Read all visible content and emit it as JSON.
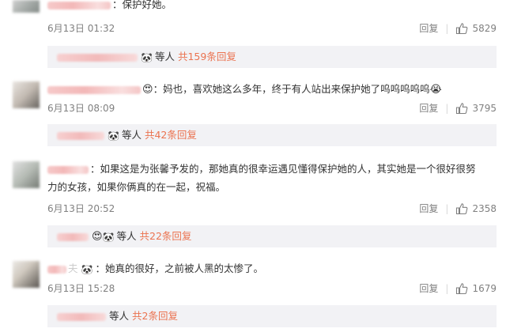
{
  "comments": [
    {
      "text": "：保护好她。",
      "date": "6月13日",
      "time": "01:32",
      "reply_label": "回复",
      "likes": "5829",
      "replies": {
        "suffix": "等人",
        "link": "共159条回复"
      }
    },
    {
      "text": "：妈也，喜欢她这么多年，终于有人站出来保护她了呜呜呜呜呜",
      "date": "6月13日",
      "time": "08:09",
      "reply_label": "回复",
      "likes": "3795",
      "replies": {
        "suffix": "等人",
        "link": "共42条回复"
      }
    },
    {
      "text_line1": "：如果这是为张馨予发的，那她真的很幸运遇见懂得保护她的人，其实她是一个很好很努",
      "text_line2": "力的女孩，如果你俩真的在一起，祝福。",
      "date": "6月13日",
      "time": "20:52",
      "reply_label": "回复",
      "likes": "2358",
      "replies": {
        "suffix": "等人",
        "link": "共22条回复"
      }
    },
    {
      "name_visible": "夫",
      "text": "：她真的很好，之前被人黑的太惨了。",
      "date": "6月13日",
      "time": "15:28",
      "reply_label": "回复",
      "likes": "1679",
      "replies": {
        "suffix": "等人",
        "link": "共2条回复"
      }
    }
  ],
  "icons": {
    "like": "thumbs-up-icon",
    "panda": "panda-emoji",
    "heart": "heart-eyes-emoji",
    "cry": "crying-emoji"
  },
  "colors": {
    "link": "#eb7350",
    "meta": "#808080",
    "reply_bg": "#f2f2f5"
  }
}
